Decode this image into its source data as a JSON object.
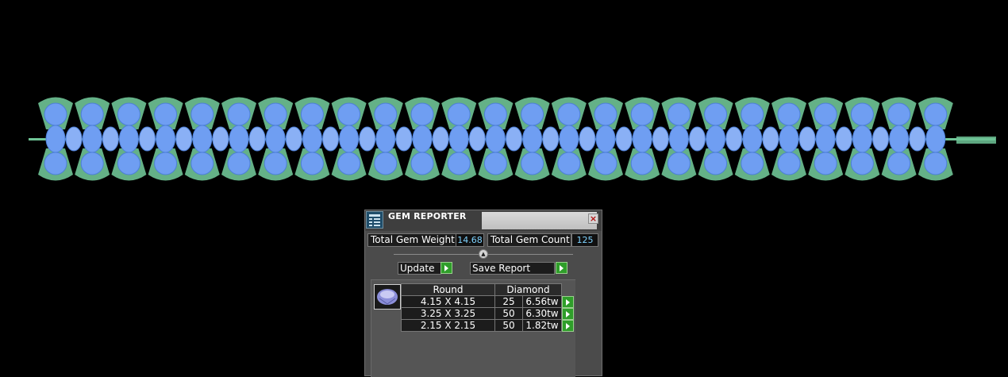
{
  "canvas": {
    "background": "#000000",
    "bracelet": {
      "link_count": 25,
      "metal_color": "#6fc496",
      "gem_color": "#6f9ef2"
    }
  },
  "gem_reporter": {
    "title": "GEM REPORTER",
    "close_glyph": "×",
    "logo_icon": "gem-reporter-logo-icon",
    "total_gem_weight_label": "Total Gem Weight",
    "total_gem_weight_value": "14.68",
    "total_gem_count_label": "Total Gem Count",
    "total_gem_count_value": "125",
    "update_label": "Update",
    "save_report_label": "Save Report",
    "table": {
      "headers": [
        "Round",
        "Diamond"
      ],
      "rows": [
        {
          "size": "4.15 X 4.15",
          "count": "25",
          "weight": "6.56tw"
        },
        {
          "size": "3.25 X 3.25",
          "count": "50",
          "weight": "6.30tw"
        },
        {
          "size": "2.15 X 2.15",
          "count": "50",
          "weight": "1.82tw"
        }
      ]
    }
  }
}
